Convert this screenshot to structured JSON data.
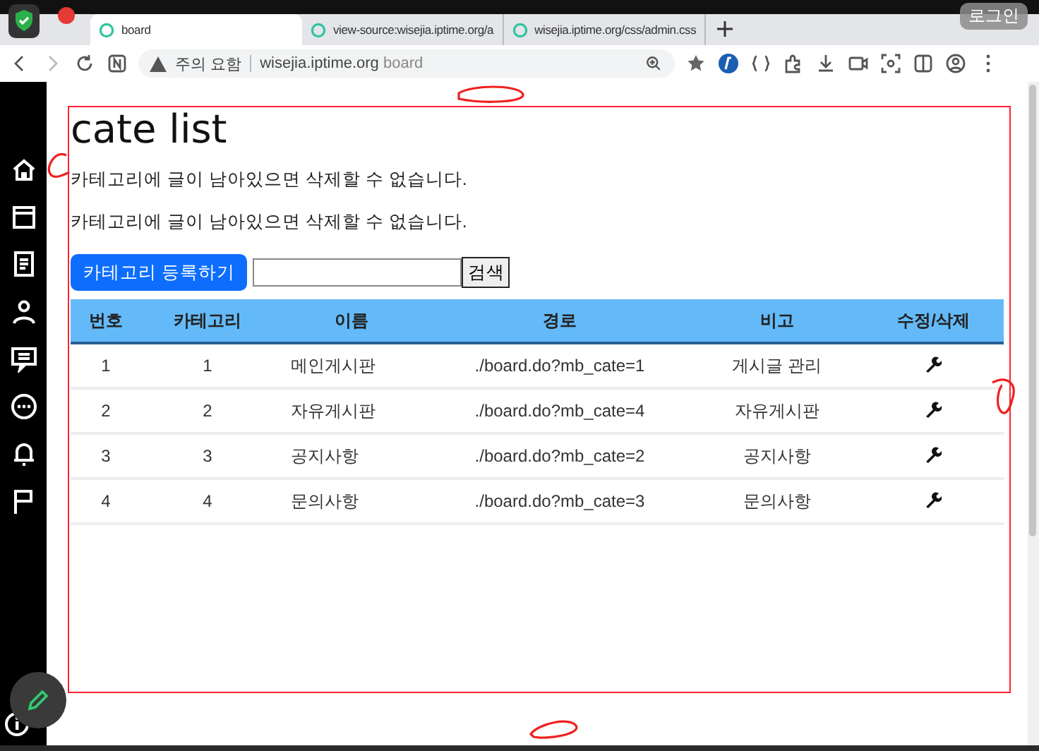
{
  "browser": {
    "tabs": [
      {
        "label": "board",
        "selected": true
      },
      {
        "label": "view-source:wisejia.iptime.org/a",
        "selected": false
      },
      {
        "label": "wisejia.iptime.org/css/admin.css",
        "selected": false
      }
    ],
    "security": "주의 요함",
    "url_host": "wisejia.iptime.org",
    "url_path": "board",
    "overlay_label": "로그인"
  },
  "page": {
    "title": "cate list",
    "notices": [
      "카테고리에 글이 남아있으면 삭제할 수 없습니다.",
      "카테고리에 글이 남아있으면 삭제할 수 없습니다."
    ],
    "register_button": "카테고리 등록하기",
    "search_button": "검색",
    "table": {
      "columns": [
        "번호",
        "카테고리",
        "이름",
        "경로",
        "비고",
        "수정/삭제"
      ],
      "rows": [
        {
          "no": "1",
          "category": "1",
          "name": "메인게시판",
          "path": "./board.do?mb_cate=1",
          "note": "게시글 관리"
        },
        {
          "no": "2",
          "category": "2",
          "name": "자유게시판",
          "path": "./board.do?mb_cate=4",
          "note": "자유게시판"
        },
        {
          "no": "3",
          "category": "3",
          "name": "공지사항",
          "path": "./board.do?mb_cate=2",
          "note": "공지사항"
        },
        {
          "no": "4",
          "category": "4",
          "name": "문의사항",
          "path": "./board.do?mb_cate=3",
          "note": "문의사항"
        }
      ]
    }
  }
}
